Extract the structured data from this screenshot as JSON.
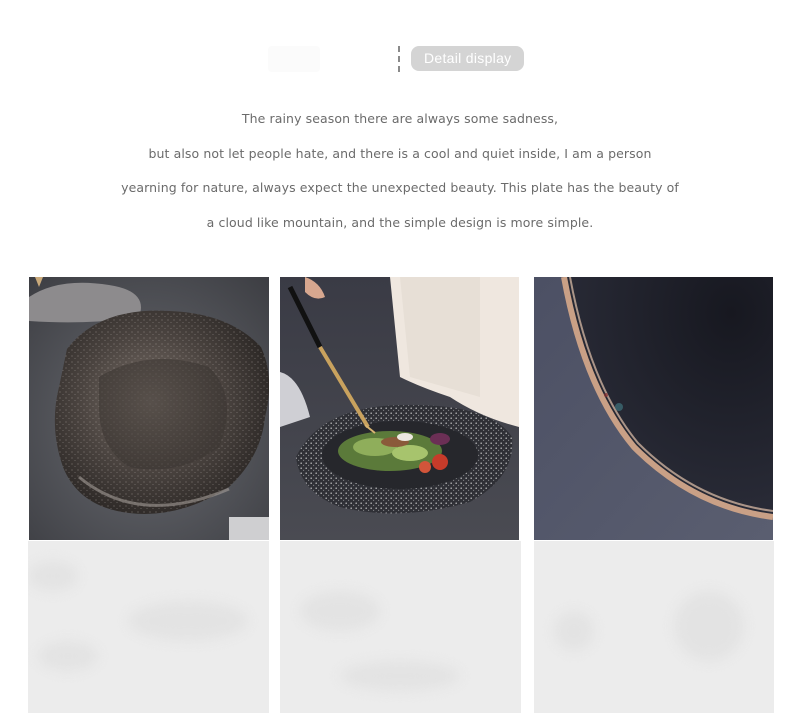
{
  "header": {
    "tag_label": "Detail display"
  },
  "description": {
    "lines": [
      "The rainy season there are always some sadness,",
      "but also not let people hate, and there is a cool and quiet inside, I am a person",
      "yearning for nature, always expect the unexpected beauty. This plate has the beauty of",
      "a cloud like mountain, and the simple design is more simple."
    ]
  },
  "colors": {
    "tag_background": "#d4d4d4",
    "text": "#6b6b6b",
    "placeholder": "#ececec"
  },
  "images": [
    {
      "subject": "dark speckled flower-shaped plate on grey cloth"
    },
    {
      "subject": "salad in speckled plate with gold fork"
    },
    {
      "subject": "close-up of dark plate rim with gold edge"
    }
  ]
}
